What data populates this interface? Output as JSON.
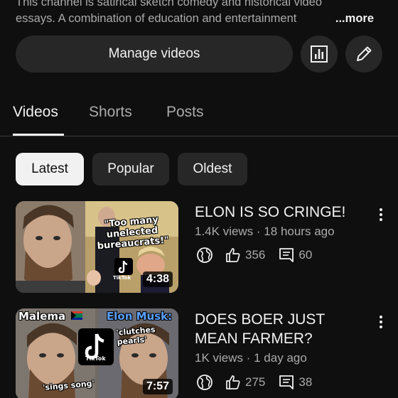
{
  "channel": {
    "description_line1": "This channel is satirical sketch comedy and historical video",
    "description_line2": "essays. A combination of education and entertainment",
    "more_label": "...more"
  },
  "actions": {
    "manage_label": "Manage videos",
    "stats_icon": "bar-chart-icon",
    "edit_icon": "pencil-icon"
  },
  "tabs": [
    {
      "label": "Videos",
      "active": true
    },
    {
      "label": "Shorts",
      "active": false
    },
    {
      "label": "Posts",
      "active": false
    }
  ],
  "filters": [
    {
      "label": "Latest",
      "active": true
    },
    {
      "label": "Popular",
      "active": false
    },
    {
      "label": "Oldest",
      "active": false
    }
  ],
  "videos": [
    {
      "title": "ELON IS SO CRINGE!",
      "meta": "1.4K views · 18 hours ago",
      "likes": "356",
      "comments": "60",
      "duration": "4:38",
      "thumb_text": {
        "quote": "\"Too many unelected bureaucrats!\"",
        "tiktok": "TikTok"
      }
    },
    {
      "title": "DOES BOER JUST MEAN FARMER?",
      "meta": "1K views · 1 day ago",
      "likes": "275",
      "comments": "38",
      "duration": "7:57",
      "thumb_text": {
        "left_name": "Malema",
        "right_name": "Elon Musk:",
        "left_caption": "'sings song'",
        "right_caption": "'clutches pearls'",
        "tiktok": "TikTok"
      }
    }
  ]
}
